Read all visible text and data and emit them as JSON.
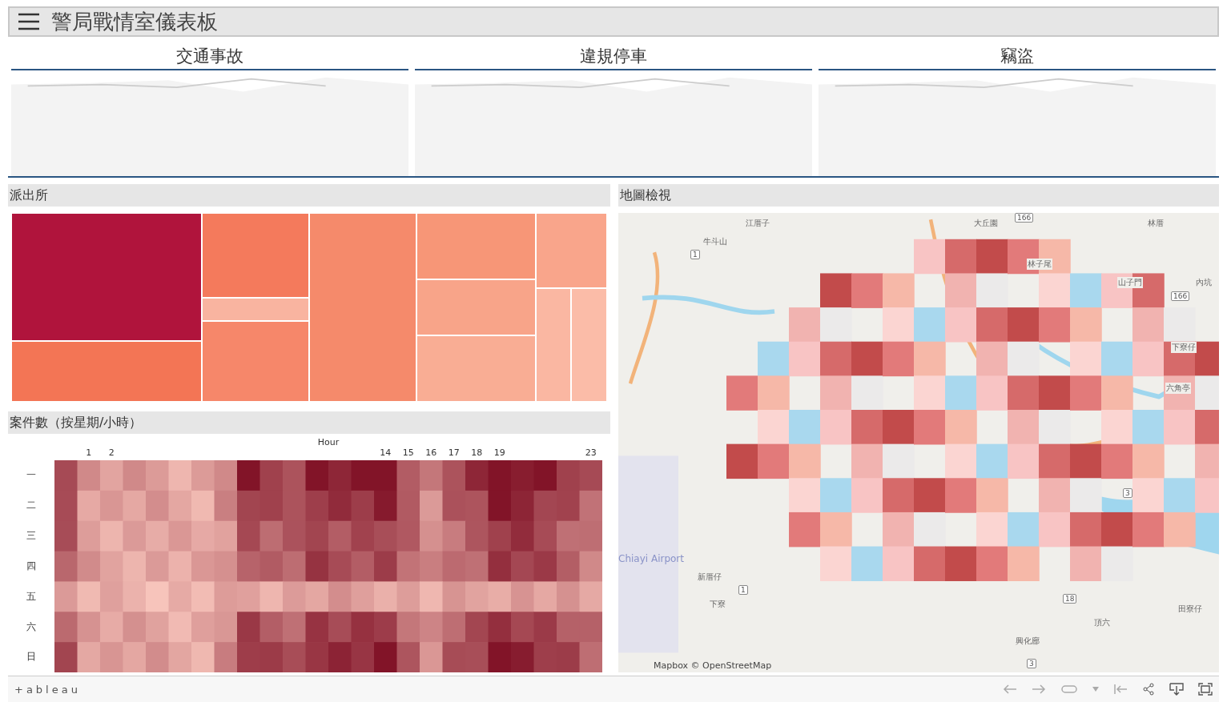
{
  "header": {
    "title": "警局戰情室儀表板"
  },
  "kpis": [
    {
      "title": "交通事故"
    },
    {
      "title": "違規停車"
    },
    {
      "title": "竊盜"
    }
  ],
  "station_panel": {
    "title": "派出所"
  },
  "heatmap": {
    "title": "案件數（按星期/小時）",
    "axis_title": "Hour",
    "hours": [
      "1",
      "2",
      "14",
      "15",
      "16",
      "17",
      "18",
      "19",
      "23"
    ],
    "days": [
      "一",
      "二",
      "三",
      "四",
      "五",
      "六",
      "日"
    ]
  },
  "map_panel": {
    "title": "地圖檢視",
    "places": [
      {
        "name": "江厝子"
      },
      {
        "name": "牛斗山"
      },
      {
        "name": "大丘園"
      },
      {
        "name": "林厝"
      },
      {
        "name": "林子尾"
      },
      {
        "name": "山子門"
      },
      {
        "name": "內坑"
      },
      {
        "name": "下寮仔"
      },
      {
        "name": "六角亭"
      },
      {
        "name": "新厝仔"
      },
      {
        "name": "下寮"
      },
      {
        "name": "田寮仔"
      },
      {
        "name": "頂六"
      },
      {
        "name": "興化廍"
      }
    ],
    "roads": [
      {
        "label": "1"
      },
      {
        "label": "166"
      },
      {
        "label": "166"
      },
      {
        "label": "3"
      },
      {
        "label": "18"
      },
      {
        "label": "1"
      },
      {
        "label": "3"
      }
    ],
    "airport": "Chiayi Airport",
    "attribution": "Mapbox © OpenStreetMap"
  },
  "footer": {
    "logo": "+ableau"
  }
}
